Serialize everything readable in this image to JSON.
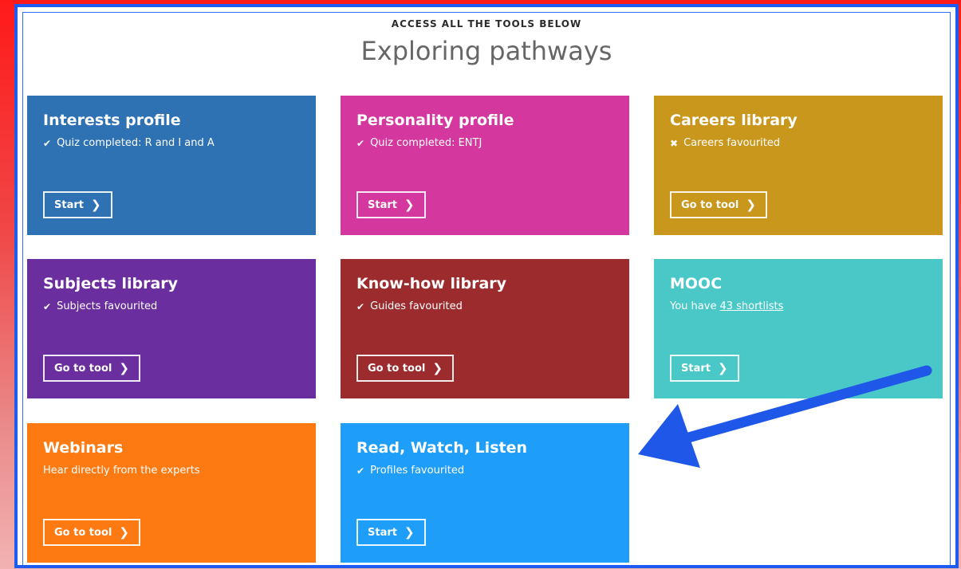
{
  "header": {
    "eyebrow": "ACCESS ALL THE TOOLS BELOW",
    "title": "Exploring pathways"
  },
  "cards": [
    {
      "title": "Interests profile",
      "status_icon": "check-icon",
      "status_glyph": "✔",
      "status": "Quiz completed: R and I and A",
      "button": "Start",
      "color": "#2e72b3"
    },
    {
      "title": "Personality profile",
      "status_icon": "check-icon",
      "status_glyph": "✔",
      "status": "Quiz completed: ENTJ",
      "button": "Start",
      "color": "#d4389f"
    },
    {
      "title": "Careers library",
      "status_icon": "cross-icon",
      "status_glyph": "✖",
      "status": "Careers favourited",
      "button": "Go to tool",
      "color": "#c9971c"
    },
    {
      "title": "Subjects library",
      "status_icon": "check-icon",
      "status_glyph": "✔",
      "status": "Subjects favourited",
      "button": "Go to tool",
      "color": "#6a2e9e"
    },
    {
      "title": "Know-how library",
      "status_icon": "check-icon",
      "status_glyph": "✔",
      "status": "Guides favourited",
      "button": "Go to tool",
      "color": "#9b2b2d"
    },
    {
      "title": "MOOC",
      "status_prefix": "You have",
      "status_link": "43 shortlists",
      "button": "Start",
      "color": "#4ac8c8"
    },
    {
      "title": "Webinars",
      "status": "Hear directly from the experts",
      "button": "Go to tool",
      "color": "#fd7a12"
    },
    {
      "title": "Read, Watch, Listen",
      "status_icon": "check-icon",
      "status_glyph": "✔",
      "status": "Profiles favourited",
      "button": "Start",
      "color": "#1e9ef8"
    }
  ],
  "chevron_glyph": "❯",
  "annotation": {
    "arrow_icon": "arrow-icon",
    "color": "#1f58e8"
  }
}
